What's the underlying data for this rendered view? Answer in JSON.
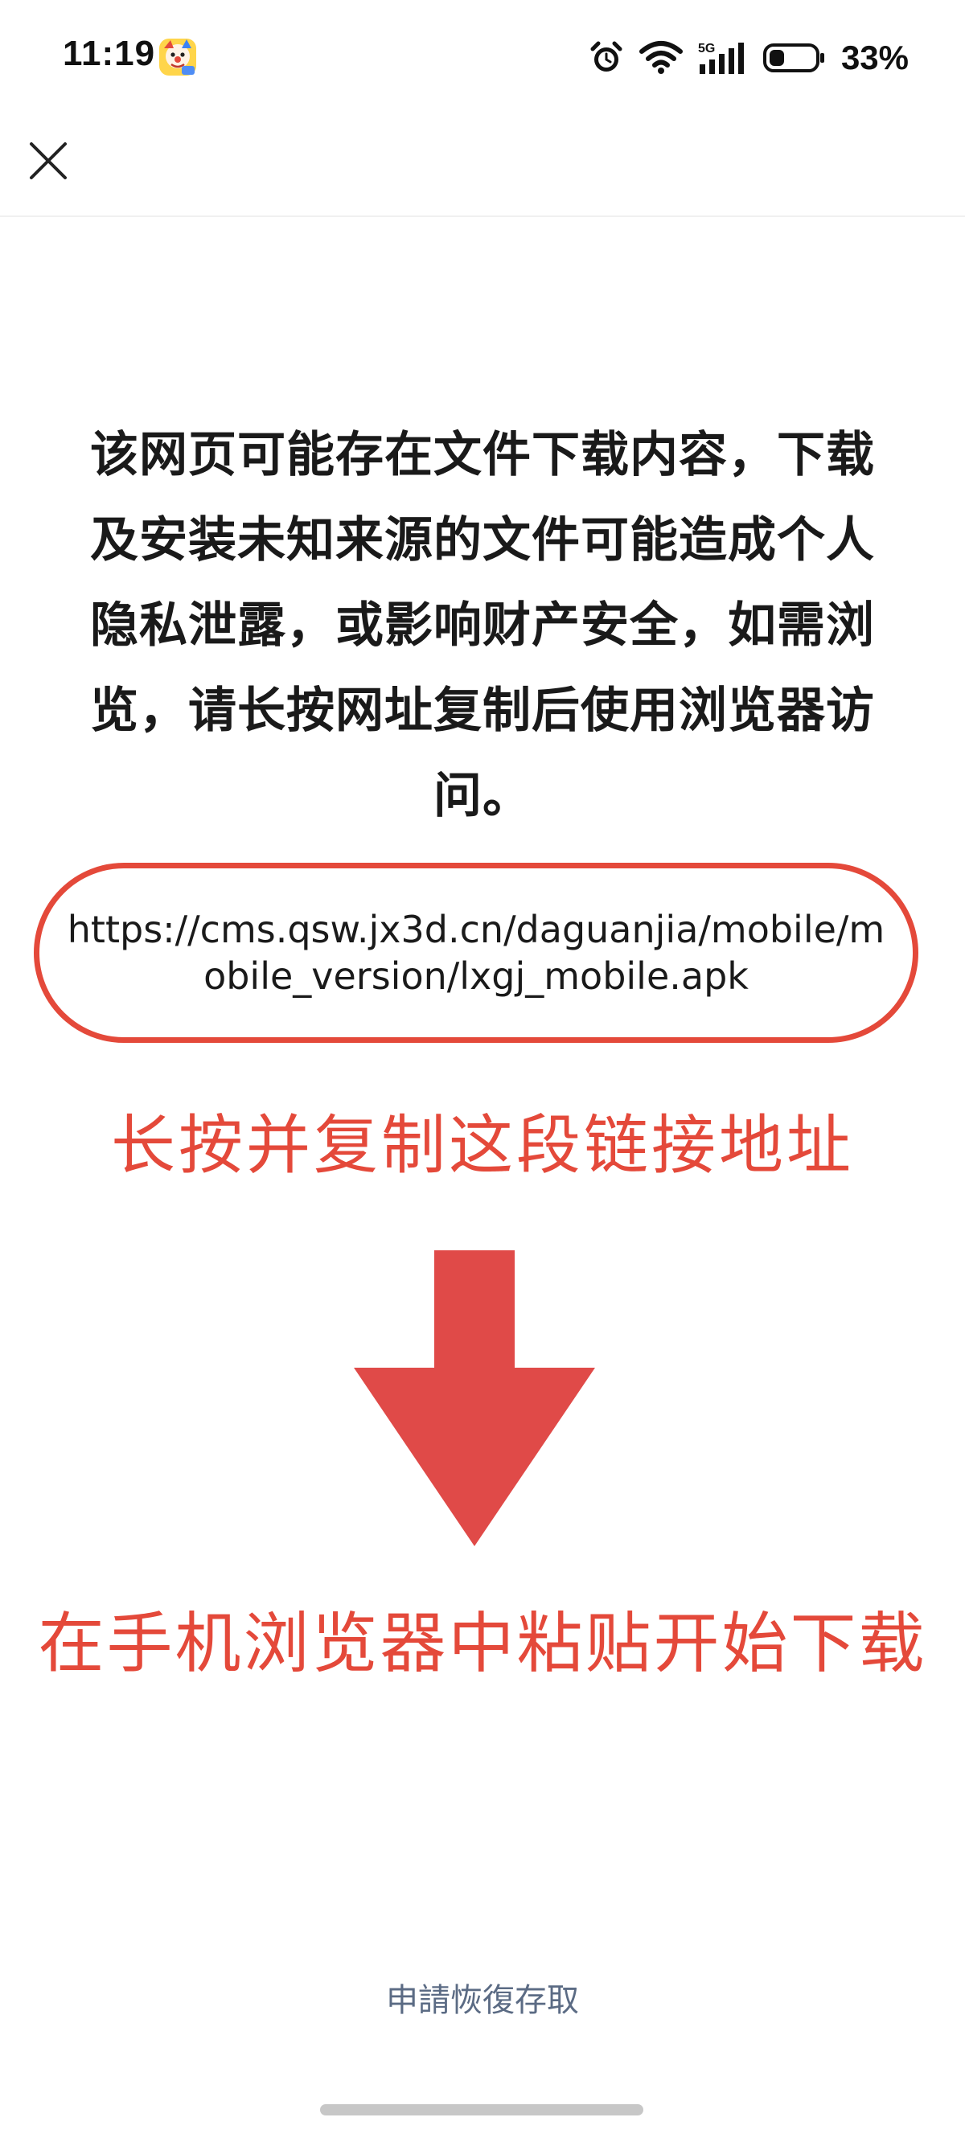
{
  "status_bar": {
    "time": "11:19",
    "app_badge_icon": "clown-face-app-icon",
    "icons": [
      "alarm-icon",
      "wifi-icon",
      "5g-signal-icon",
      "battery-icon"
    ],
    "network_label": "5G",
    "battery_text": "33%",
    "battery_level": 0.33
  },
  "top_bar": {
    "close_icon": "close-icon"
  },
  "main": {
    "warning_text": "该网页可能存在文件下载内容，下载及安装未知来源的文件可能造成个人隐私泄露，或影响财产安全，如需浏览，请长按网址复制后使用浏览器访问。",
    "url": "https://cms.qsw.jx3d.cn/daguanjia/mobile/mobile_version/lxgj_mobile.apk",
    "instruction_copy": "长按并复制这段链接地址",
    "arrow_icon": "down-arrow-icon",
    "instruction_paste": "在手机浏览器中粘贴开始下载",
    "restore_link": "申請恢復存取"
  },
  "colors": {
    "accent_red": "#e4493a",
    "arrow_red": "#e04a48",
    "link_gray_blue": "#5b6b84",
    "text": "#1a1a1a"
  }
}
